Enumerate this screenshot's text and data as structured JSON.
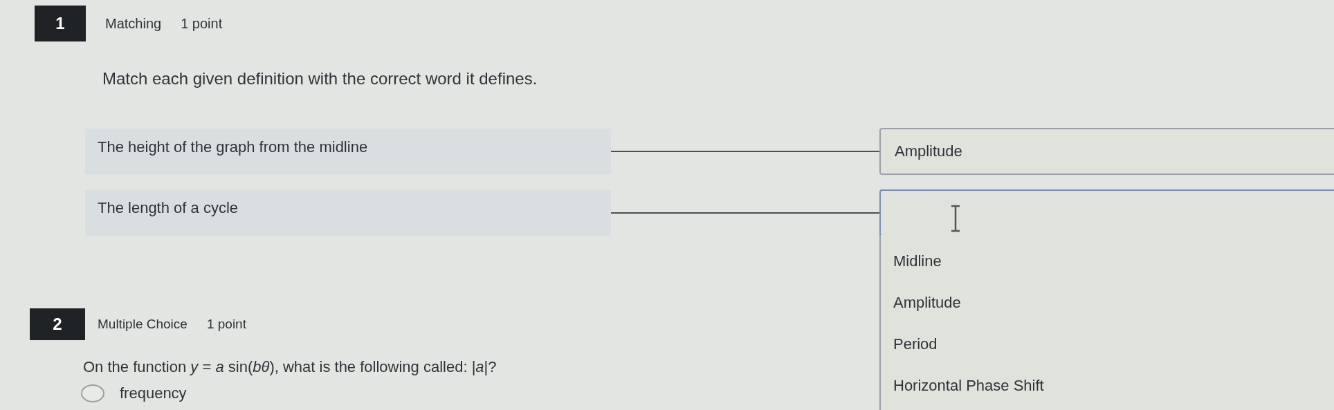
{
  "questions": [
    {
      "kind": "matching",
      "number": "1",
      "type": "Matching",
      "points": "1 point",
      "prompt": "Match each given definition with the correct word it defines.",
      "pairs": [
        {
          "definition": "The height of the graph from the midline",
          "answer": "Amplitude",
          "focused": false
        },
        {
          "definition": "The length of a cycle",
          "focused": true
        }
      ],
      "dropdown_options": [
        "Midline",
        "Amplitude",
        "Period",
        "Horizontal Phase Shift"
      ]
    },
    {
      "kind": "multiple_choice",
      "number": "2",
      "type": "Multiple Choice",
      "points": "1 point",
      "prompt": "On the function *y* = *a* sin(*bθ*), what is the following called: |*a*|?",
      "choices": [
        {
          "label": "frequency",
          "selected": false
        }
      ]
    }
  ]
}
